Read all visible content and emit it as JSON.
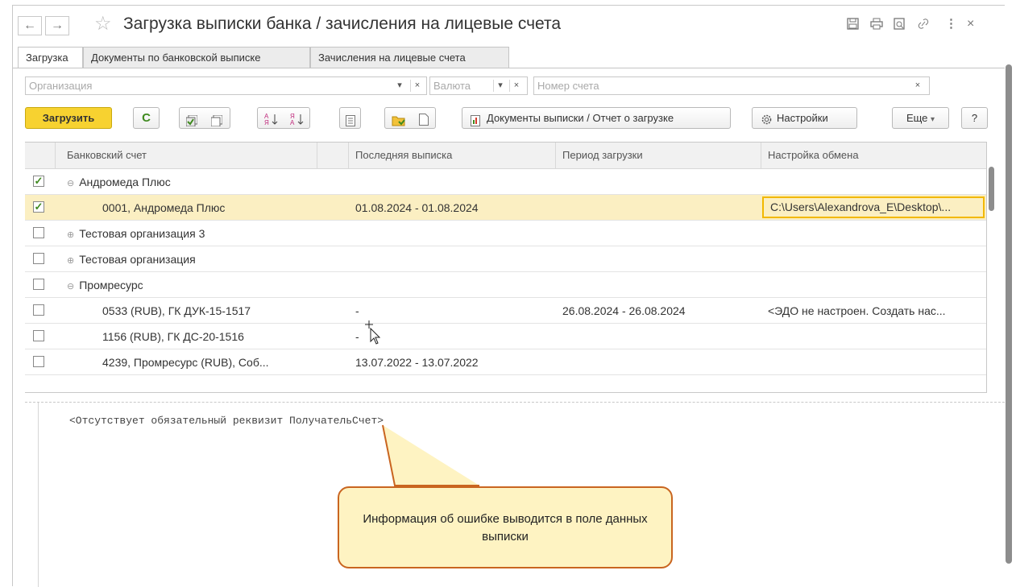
{
  "window": {
    "title": "Загрузка выписки банка / зачисления на лицевые счета",
    "back": "←",
    "forward": "→",
    "star": "☆",
    "icons": [
      "save-icon",
      "print-icon",
      "preview-icon",
      "link-icon",
      "more-icon",
      "close-icon"
    ],
    "close": "×",
    "more": "⋮"
  },
  "tabs": [
    {
      "label": "Загрузка",
      "active": true
    },
    {
      "label": "Документы по банковской выписке",
      "active": false
    },
    {
      "label": "Зачисления на лицевые счета",
      "active": false
    }
  ],
  "filters": {
    "organization_placeholder": "Организация",
    "currency_placeholder": "Валюта",
    "account_placeholder": "Номер счета",
    "dropdown": "▾",
    "clear": "×"
  },
  "toolbar": {
    "load": "Загрузить",
    "refresh": "C",
    "documents_report": "Документы выписки / Отчет о загрузке",
    "settings": "Настройки",
    "more": "Еще",
    "more_arrow": "▾",
    "help": "?"
  },
  "table": {
    "columns": [
      "Банковский счет",
      "Последняя выписка",
      "Период загрузки",
      "Настройка обмена"
    ],
    "rows": [
      {
        "checked": true,
        "toggle": "⊖",
        "account": "Андромеда Плюс",
        "last": "",
        "period": "",
        "exchange": "",
        "level": 0
      },
      {
        "checked": true,
        "toggle": "",
        "account": "0001, Андромеда Плюс",
        "last": "01.08.2024 - 01.08.2024",
        "period": "",
        "exchange": "C:\\Users\\Alexandrova_E\\Desktop\\...",
        "level": 1,
        "selected": true
      },
      {
        "checked": false,
        "toggle": "⊕",
        "account": "Тестовая организация 3",
        "last": "",
        "period": "",
        "exchange": "",
        "level": 0
      },
      {
        "checked": false,
        "toggle": "⊕",
        "account": "Тестовая организация",
        "last": "",
        "period": "",
        "exchange": "",
        "level": 0
      },
      {
        "checked": false,
        "toggle": "⊖",
        "account": "Промресурс",
        "last": "",
        "period": "",
        "exchange": "",
        "level": 0
      },
      {
        "checked": false,
        "toggle": "",
        "account": "0533 (RUB), ГК ДУК-15-1517",
        "last": "-",
        "period": "26.08.2024 - 26.08.2024",
        "exchange": "<ЭДО не настроен. Создать нас...",
        "level": 1
      },
      {
        "checked": false,
        "toggle": "",
        "account": "1156 (RUB), ГК ДС-20-1516",
        "last": "-",
        "period": "",
        "exchange": "",
        "level": 1
      },
      {
        "checked": false,
        "toggle": "",
        "account": "4239, Промресурс (RUB), Соб...",
        "last": "13.07.2022 - 13.07.2022",
        "period": "",
        "exchange": "",
        "level": 1
      }
    ]
  },
  "statement_data": "<Отсутствует обязательный реквизит ПолучательСчет>",
  "callout": "Информация об ошибке выводится в поле данных выписки"
}
